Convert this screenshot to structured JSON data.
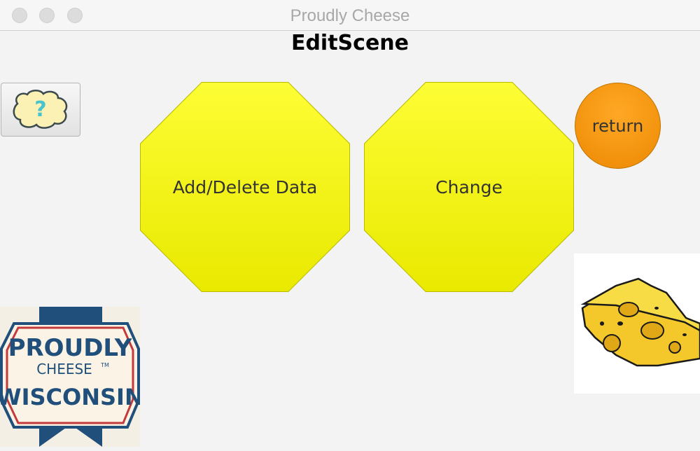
{
  "window": {
    "title": "Proudly Cheese"
  },
  "scene": {
    "title": "EditScene"
  },
  "buttons": {
    "help_label": "?",
    "add_delete_label": "Add/Delete Data",
    "change_label": "Change",
    "return_label": "return"
  },
  "logo": {
    "line1": "PROUDLY",
    "line2": "CHEESE",
    "trademark": "TM",
    "line3": "WISCONSIN"
  },
  "colors": {
    "octagon_fill": "#f5f514",
    "return_fill": "#f2920c",
    "logo_navy": "#1f4f7a",
    "logo_red": "#c23a3a"
  },
  "icons": {
    "help": "cheese-question-icon",
    "cheese": "cheese-wedge-image"
  }
}
